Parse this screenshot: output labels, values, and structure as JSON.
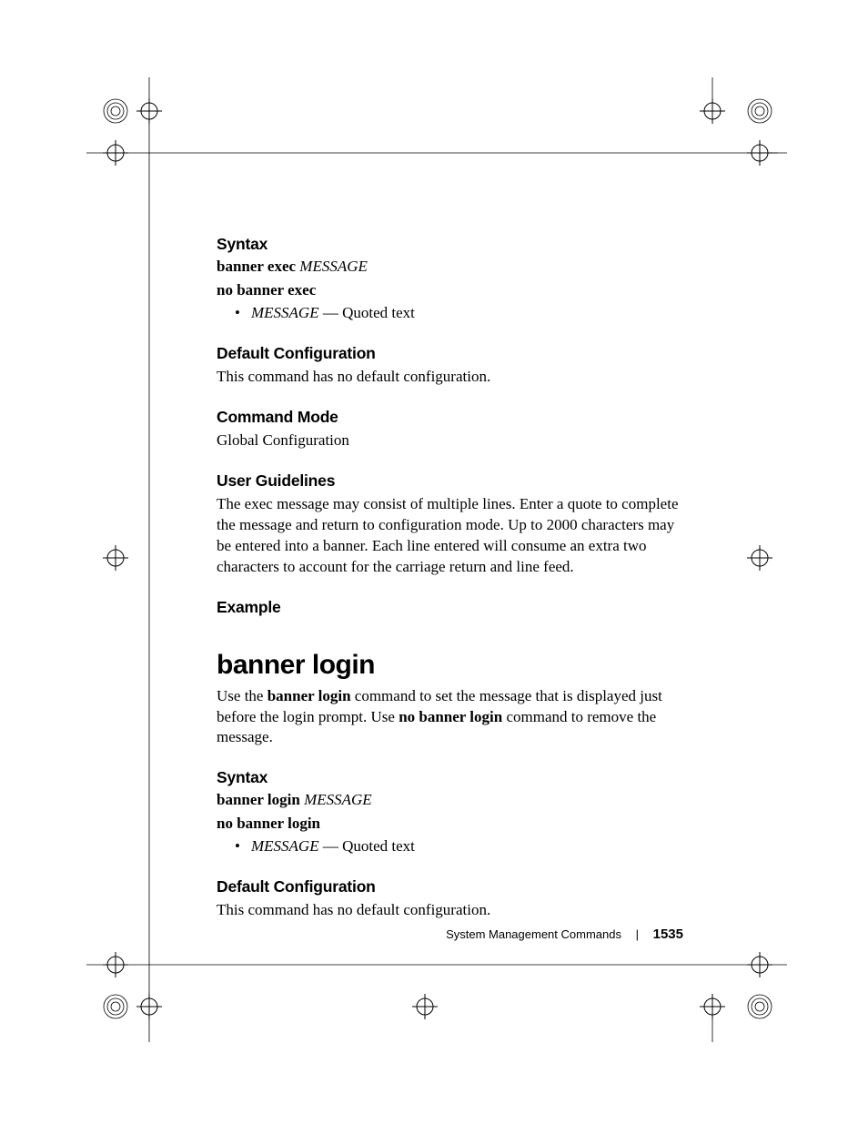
{
  "sec1": {
    "syntax_head": "Syntax",
    "syn_kw": "banner exec",
    "syn_arg": "MESSAGE",
    "no_line": "no banner exec",
    "bullet_arg": "MESSAGE",
    "bullet_rest": " — Quoted text",
    "defcfg_head": "Default Configuration",
    "defcfg_body": "This command has no default configuration.",
    "mode_head": "Command Mode",
    "mode_body": "Global Configuration",
    "ug_head": "User Guidelines",
    "ug_body": "The exec message may consist of multiple lines. Enter a quote to complete the message and return to configuration mode. Up to 2000 characters may be entered into a banner. Each line entered will consume an extra two characters to account for the carriage return and line feed.",
    "ex_head": "Example"
  },
  "cmd2": {
    "title": "banner login",
    "intro_a": "Use the ",
    "intro_b1": "banner login",
    "intro_c": " command to set the message that is displayed just before the login prompt. Use ",
    "intro_b2": "no banner login",
    "intro_d": " command to remove the message.",
    "syntax_head": "Syntax",
    "syn_kw": "banner login",
    "syn_arg": "MESSAGE",
    "no_line": "no banner login",
    "bullet_arg": "MESSAGE",
    "bullet_rest": " — Quoted text",
    "defcfg_head": "Default Configuration",
    "defcfg_body": "This command has no default configuration."
  },
  "footer": {
    "section": "System Management Commands",
    "page": "1535"
  }
}
